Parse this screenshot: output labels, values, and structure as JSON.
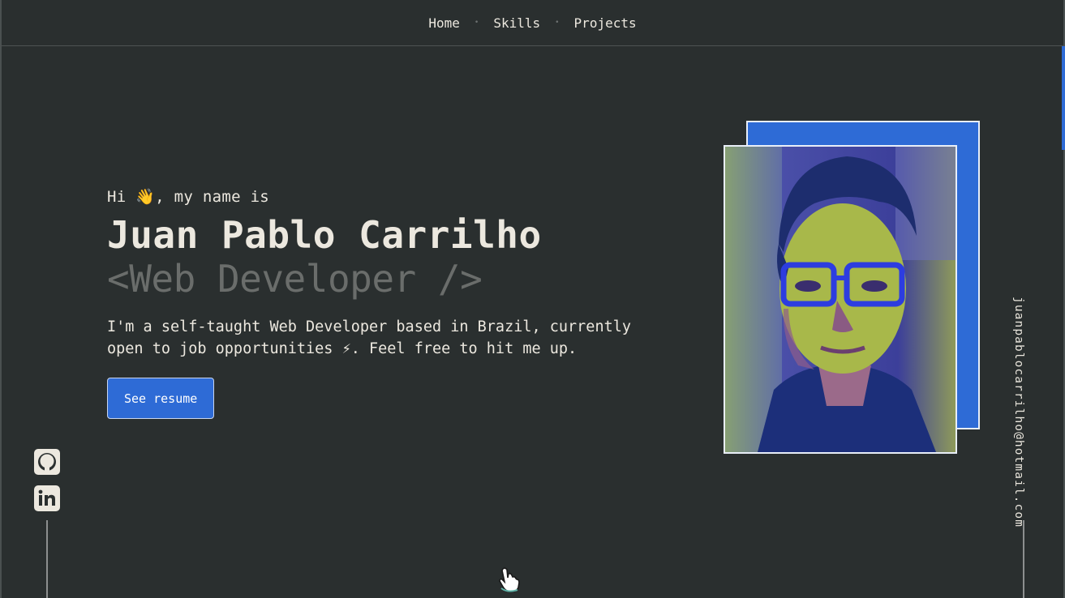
{
  "nav": {
    "items": [
      {
        "label": "Home"
      },
      {
        "label": "Skills"
      },
      {
        "label": "Projects"
      }
    ],
    "separator": "•"
  },
  "hero": {
    "greeting": "Hi 👋, my name is",
    "name": "Juan Pablo Carrilho",
    "role": "<Web Developer />",
    "bio": "I'm a self-taught Web Developer based in Brazil, currently open to job opportunities ⚡. Feel free to hit me up.",
    "resume_label": "See resume"
  },
  "contact": {
    "email": "juanpablocarrilho@hotmail.com"
  },
  "social": {
    "icons": [
      "github-icon",
      "linkedin-icon"
    ]
  },
  "colors": {
    "background": "#2a2f2f",
    "text": "#ece8df",
    "accent": "#2e6bd6",
    "muted": "#6a6d6b"
  }
}
